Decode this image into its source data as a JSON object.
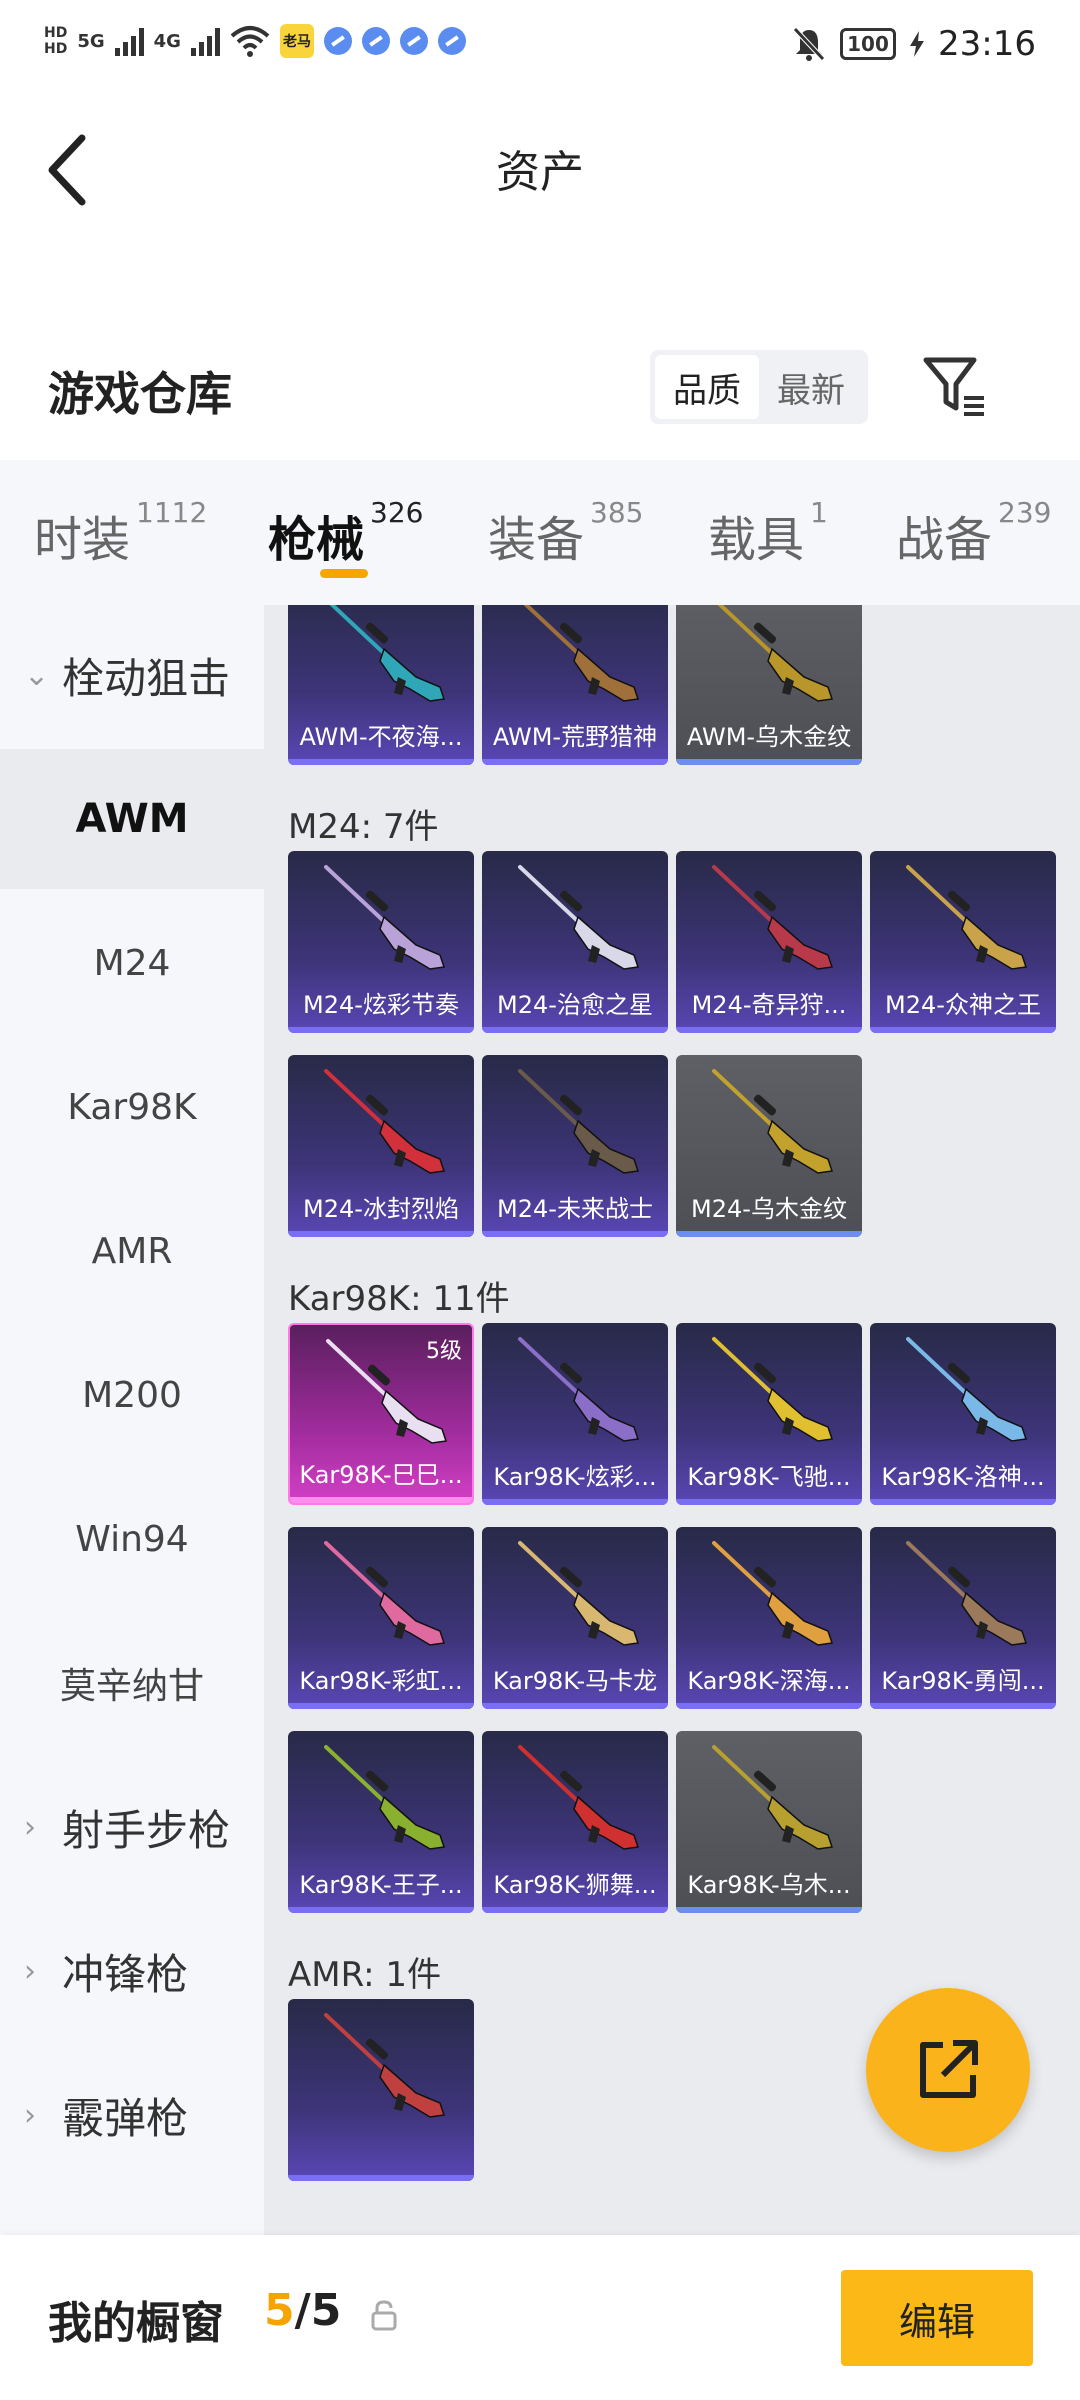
{
  "status_bar": {
    "hd1": "HD",
    "hd2": "HD",
    "net1": "5G",
    "net2": "4G",
    "app_icon_text": "老马",
    "battery": "100",
    "time": "23:16"
  },
  "header": {
    "title": "资产"
  },
  "warehouse": {
    "title": "游戏仓库",
    "sort_options": [
      "品质",
      "最新"
    ],
    "active_sort": "品质"
  },
  "tabs": [
    {
      "label": "时装",
      "count": "1112"
    },
    {
      "label": "枪械",
      "count": "326",
      "active": true
    },
    {
      "label": "装备",
      "count": "385"
    },
    {
      "label": "载具",
      "count": "1"
    },
    {
      "label": "战备",
      "count": "239"
    }
  ],
  "sidebar": {
    "items": [
      {
        "label": "栓动狙击",
        "type": "category",
        "chevron": "⌄"
      },
      {
        "label": "AWM",
        "type": "sub",
        "active": true
      },
      {
        "label": "M24",
        "type": "sub"
      },
      {
        "label": "Kar98K",
        "type": "sub"
      },
      {
        "label": "AMR",
        "type": "sub"
      },
      {
        "label": "M200",
        "type": "sub"
      },
      {
        "label": "Win94",
        "type": "sub"
      },
      {
        "label": "莫辛纳甘",
        "type": "sub"
      },
      {
        "label": "射手步枪",
        "type": "category",
        "chevron": "›"
      },
      {
        "label": "冲锋枪",
        "type": "category",
        "chevron": "›"
      },
      {
        "label": "霰弹枪",
        "type": "category",
        "chevron": "›"
      }
    ]
  },
  "sections": [
    {
      "title": "",
      "items": [
        {
          "name": "AWM-不夜海...",
          "style": "purple",
          "gun_color": "#2fa7b8"
        },
        {
          "name": "AWM-荒野猎神",
          "style": "purple",
          "gun_color": "#a0703a"
        },
        {
          "name": "AWM-乌木金纹",
          "style": "gray",
          "gun_color": "#b8962a"
        }
      ]
    },
    {
      "title": "M24: 7件",
      "items": [
        {
          "name": "M24-炫彩节奏",
          "style": "purple",
          "gun_color": "#b9a2d8"
        },
        {
          "name": "M24-治愈之星",
          "style": "purple",
          "gun_color": "#d8d8e8"
        },
        {
          "name": "M24-奇异狩...",
          "style": "purple",
          "gun_color": "#b83a4a"
        },
        {
          "name": "M24-众神之王",
          "style": "purple",
          "gun_color": "#c9a34a"
        },
        {
          "name": "M24-冰封烈焰",
          "style": "purple",
          "gun_color": "#d2303a"
        },
        {
          "name": "M24-未来战士",
          "style": "purple",
          "gun_color": "#6a5a4a"
        },
        {
          "name": "M24-乌木金纹",
          "style": "gray",
          "gun_color": "#c2a22c"
        }
      ]
    },
    {
      "title": "Kar98K: 11件",
      "items": [
        {
          "name": "Kar98K-巳巳...",
          "style": "pink",
          "gun_color": "#e8e0f0",
          "level": "5级"
        },
        {
          "name": "Kar98K-炫彩...",
          "style": "purple",
          "gun_color": "#8a6ec8"
        },
        {
          "name": "Kar98K-飞驰...",
          "style": "purple",
          "gun_color": "#e0c030"
        },
        {
          "name": "Kar98K-洛神...",
          "style": "purple",
          "gun_color": "#7ab8e8"
        },
        {
          "name": "Kar98K-彩虹...",
          "style": "purple",
          "gun_color": "#e06aa0"
        },
        {
          "name": "Kar98K-马卡龙",
          "style": "purple",
          "gun_color": "#d8b870"
        },
        {
          "name": "Kar98K-深海...",
          "style": "purple",
          "gun_color": "#e0a040"
        },
        {
          "name": "Kar98K-勇闯...",
          "style": "purple",
          "gun_color": "#9a7a5a"
        },
        {
          "name": "Kar98K-王子...",
          "style": "purple",
          "gun_color": "#8ab030"
        },
        {
          "name": "Kar98K-狮舞...",
          "style": "purple",
          "gun_color": "#d03030"
        },
        {
          "name": "Kar98K-乌木...",
          "style": "gray",
          "gun_color": "#b8a030"
        }
      ]
    },
    {
      "title": "AMR: 1件",
      "items": [
        {
          "name": "",
          "style": "purple",
          "gun_color": "#c04040"
        }
      ]
    }
  ],
  "bottom_bar": {
    "showcase_label": "我的橱窗",
    "current": "5",
    "separator": "/",
    "total": "5",
    "edit_label": "编辑"
  },
  "colors": {
    "accent": "#f5a400",
    "edit_button": "#fbb817",
    "fab": "#fbb31c",
    "tab_bg": "#f5f7fb",
    "content_bg": "#e9ebef"
  }
}
